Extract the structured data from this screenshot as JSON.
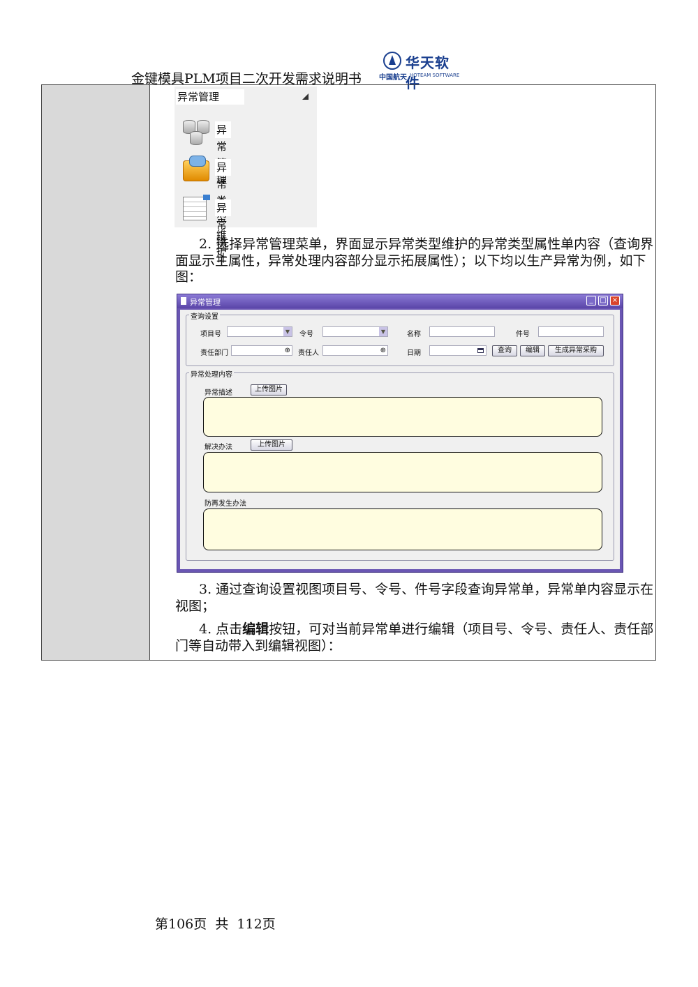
{
  "header": {
    "doc_title": "金键模具PLM项目二次开发需求说明书",
    "logo": {
      "brand": "华天软件",
      "sub_cn": "中国航天",
      "sub_en": "HOTEAM SOFTWARE"
    }
  },
  "menu_panel": {
    "title": "异常管理",
    "items": [
      {
        "label": "异常管理",
        "icon": "database-icon"
      },
      {
        "label": "异常类型维护",
        "icon": "toolbox-icon"
      },
      {
        "label": "异常统计",
        "icon": "spreadsheet-icon"
      }
    ]
  },
  "paragraphs": {
    "p2": "2.  选择异常管理菜单，界面显示异常类型维护的异常类型属性单内容（查询界面显示主属性，异常处理内容部分显示拓展属性）；以下均以生产异常为例，如下图：",
    "p3": "3.  通过查询设置视图项目号、令号、件号字段查询异常单，异常单内容显示在视图；",
    "p4_pre": "4.  点击",
    "p4_bold": "编辑",
    "p4_post": "按钮，可对当前异常单进行编辑（项目号、令号、责任人、责任部门等自动带入到编辑视图）："
  },
  "window": {
    "title": "异常管理",
    "query_group": "查询设置",
    "fields": {
      "project_no": "项目号",
      "order_no": "令号",
      "name": "名称",
      "part_no": "件号",
      "dept": "责任部门",
      "owner": "责任人",
      "date": "日期"
    },
    "buttons": {
      "query": "查询",
      "edit": "编辑",
      "gen_purchase": "生成异常采购"
    },
    "process_group": "异常处理内容",
    "sections": {
      "desc": "异常描述",
      "solution": "解决办法",
      "prevent": "防再发生办法"
    },
    "upload_label": "上传图片"
  },
  "footer": {
    "page": "第106页  共  112页"
  }
}
